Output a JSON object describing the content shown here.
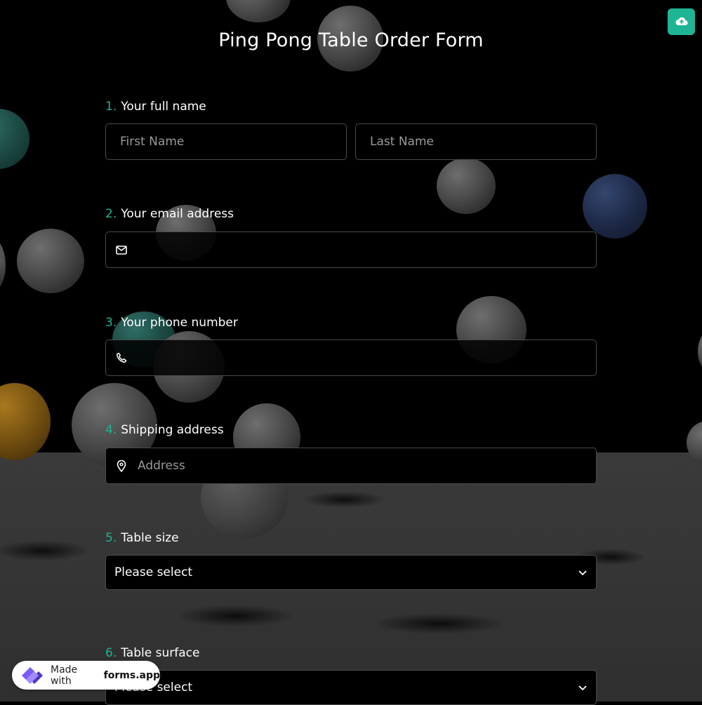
{
  "title": "Ping Pong Table Order Form",
  "toolbar": {
    "upload_icon": "cloud-upload-icon",
    "accent": "#1fb494"
  },
  "questions": [
    {
      "num": "1.",
      "label": "Your full name",
      "fields": [
        {
          "placeholder": "First Name"
        },
        {
          "placeholder": "Last Name"
        }
      ]
    },
    {
      "num": "2.",
      "label": "Your email address",
      "icon": "envelope-icon",
      "placeholder": ""
    },
    {
      "num": "3.",
      "label": "Your phone number",
      "icon": "phone-icon",
      "placeholder": ""
    },
    {
      "num": "4.",
      "label": "Shipping address",
      "icon": "location-pin-icon",
      "placeholder": "Address"
    },
    {
      "num": "5.",
      "label": "Table size",
      "selected": "Please select"
    },
    {
      "num": "6.",
      "label": "Table surface",
      "selected": "Please select"
    }
  ],
  "badge": {
    "prefix": "Made with",
    "brand": "forms.app"
  }
}
